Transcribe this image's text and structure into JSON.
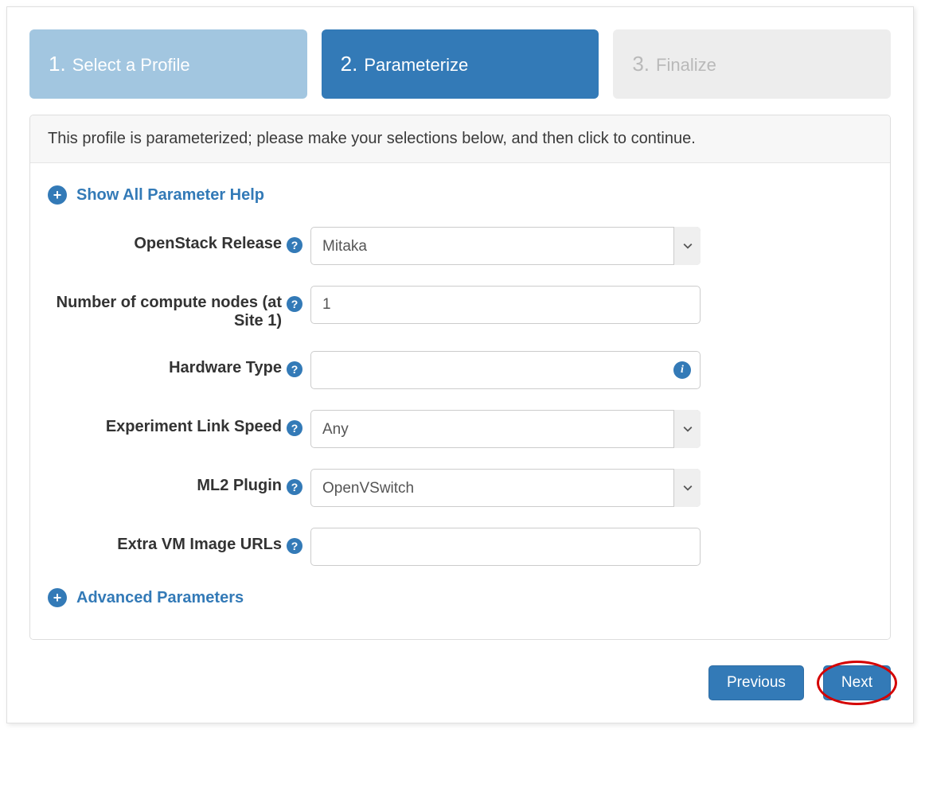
{
  "steps": [
    {
      "num": "1.",
      "label": "Select a Profile"
    },
    {
      "num": "2.",
      "label": "Parameterize"
    },
    {
      "num": "3.",
      "label": "Finalize"
    }
  ],
  "instruction": "This profile is parameterized; please make your selections below, and then click to continue.",
  "show_all_help": "Show All Parameter Help",
  "advanced_label": "Advanced Parameters",
  "fields": {
    "openstack_release": {
      "label": "OpenStack Release",
      "value": "Mitaka"
    },
    "compute_nodes": {
      "label": "Number of compute nodes (at Site 1)",
      "value": "1"
    },
    "hardware_type": {
      "label": "Hardware Type",
      "value": ""
    },
    "link_speed": {
      "label": "Experiment Link Speed",
      "value": "Any"
    },
    "ml2_plugin": {
      "label": "ML2 Plugin",
      "value": "OpenVSwitch"
    },
    "extra_vm_urls": {
      "label": "Extra VM Image URLs",
      "value": ""
    }
  },
  "buttons": {
    "previous": "Previous",
    "next": "Next"
  }
}
